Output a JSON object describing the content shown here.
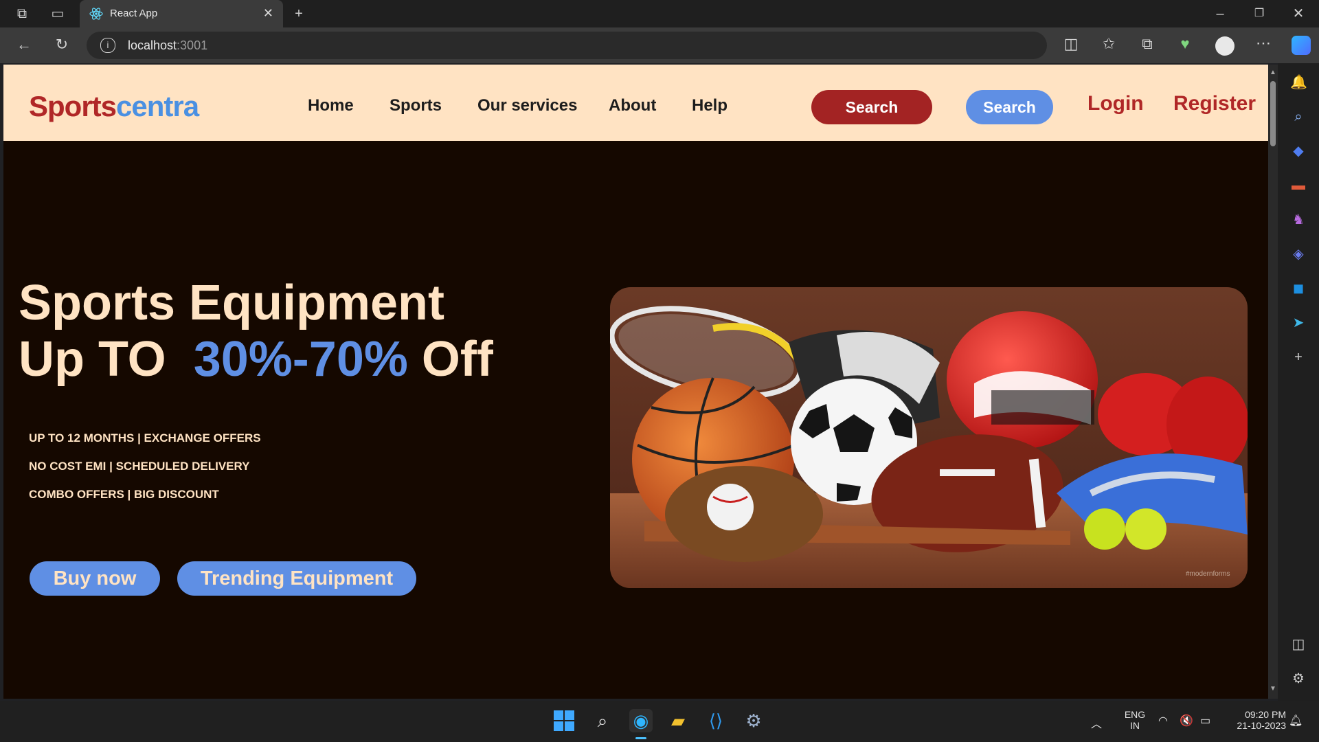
{
  "browser": {
    "tab_title": "React App",
    "url_host": "localhost",
    "url_port": ":3001"
  },
  "site": {
    "logo_part1": "Sports",
    "logo_part2": "centra",
    "nav": [
      "Home",
      "Sports",
      "Our services",
      "About",
      "Help"
    ],
    "search_button_1": "Search",
    "search_button_2": "Search",
    "login": "Login",
    "register": "Register",
    "headline_line1": "Sports Equipment",
    "headline_line2_prefix": "Up TO",
    "headline_highlight": "30%-70%",
    "headline_suffix": "Off",
    "offers": [
      "UP TO 12 MONTHS | EXCHANGE OFFERS",
      "NO COST EMI | SCHEDULED DELIVERY",
      "COMBO OFFERS | BIG DISCOUNT"
    ],
    "cta_buy": "Buy now",
    "cta_trending": "Trending Equipment",
    "hero_watermark": "#modernforms"
  },
  "taskbar": {
    "lang_line1": "ENG",
    "lang_line2": "IN",
    "time": "09:20 PM",
    "date": "21-10-2023"
  },
  "colors": {
    "header_bg": "#ffe3c3",
    "page_bg": "#150800",
    "accent_red": "#a32323",
    "accent_blue": "#5f8fe4"
  }
}
